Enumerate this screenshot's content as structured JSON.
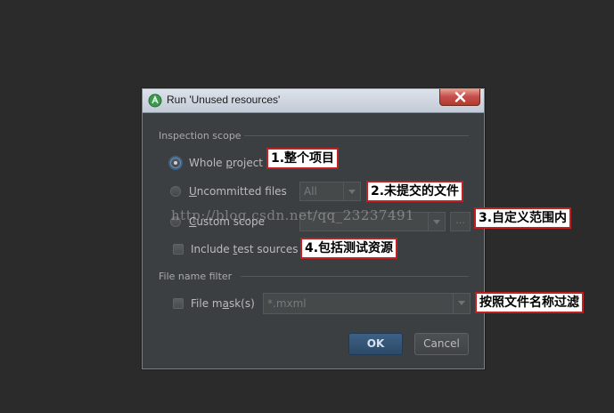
{
  "dialog": {
    "title": "Run 'Unused resources'",
    "inspection_scope": {
      "label": "Inspection scope",
      "options": {
        "whole_project": {
          "pre": "Whole ",
          "mn": "p",
          "post": "roject",
          "checked": true
        },
        "uncommitted_files": {
          "pre": "",
          "mn": "U",
          "post": "ncommitted files",
          "checked": false
        },
        "custom_scope": {
          "pre": "",
          "mn": "C",
          "post": "ustom scope",
          "checked": false
        }
      },
      "uncommitted_combo_value": "All",
      "custom_scope_browse": "...",
      "include_test_sources": {
        "pre": "Include ",
        "mn": "t",
        "post": "est sources",
        "checked": false
      }
    },
    "file_name_filter": {
      "label": "File name filter",
      "file_mask": {
        "pre": "File m",
        "mn": "a",
        "post": "sk(s)",
        "checked": false
      },
      "file_mask_value": "*.mxml"
    },
    "buttons": {
      "ok": "OK",
      "cancel": "Cancel"
    }
  },
  "annotations": {
    "a1": "1.整个项目",
    "a2": "2.未提交的文件",
    "a3": "3.自定义范围内",
    "a4": "4.包括测试资源",
    "a5": "按照文件名称过滤"
  },
  "watermark": "http://blog.csdn.net/qq_23237491",
  "colors": {
    "dialog_bg": "#3c3f41",
    "ok_button": "#3d6185",
    "annotation_border": "#c02020"
  }
}
